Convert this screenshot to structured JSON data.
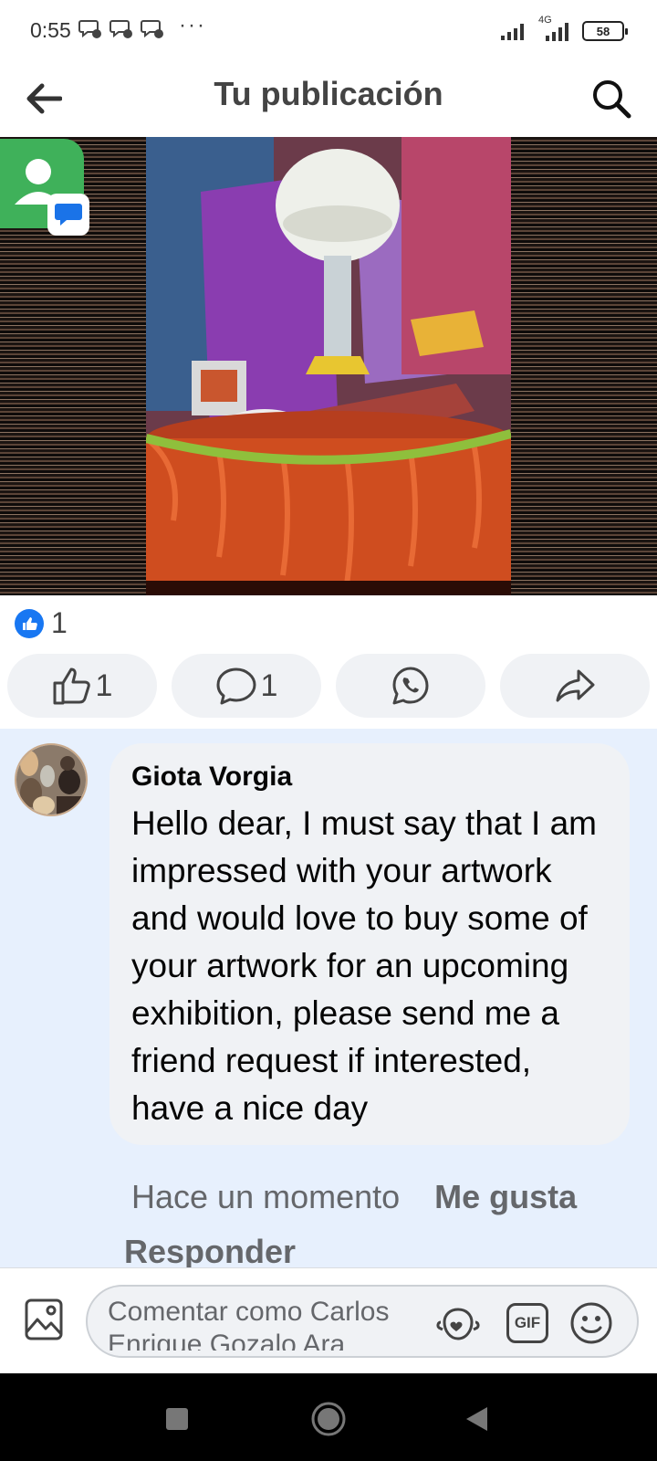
{
  "status_bar": {
    "time": "0:55",
    "dots": "···",
    "network": "4G",
    "battery": "58"
  },
  "header": {
    "title": "Tu publicación",
    "back_icon": "arrow-left-icon",
    "search_icon": "search-icon"
  },
  "post": {
    "reaction_count": "1",
    "like_count": "1",
    "comment_count": "1"
  },
  "comment": {
    "author": "Giota Vorgia",
    "text": "Hello dear, I must say that I am impressed with your artwork and would love to buy some of your artwork for an upcoming exhibition, please send me a friend request if interested, have a nice day",
    "time": "Hace un momento",
    "like_label": "Me gusta",
    "reply_label": "Responder"
  },
  "composer": {
    "placeholder": "Comentar como Carlos Enrique Gozalo Ara",
    "gif_label": "GIF"
  },
  "colors": {
    "accent": "#1877f2",
    "comment_bg": "#e7f0fd",
    "pill_bg": "#f0f2f5"
  }
}
